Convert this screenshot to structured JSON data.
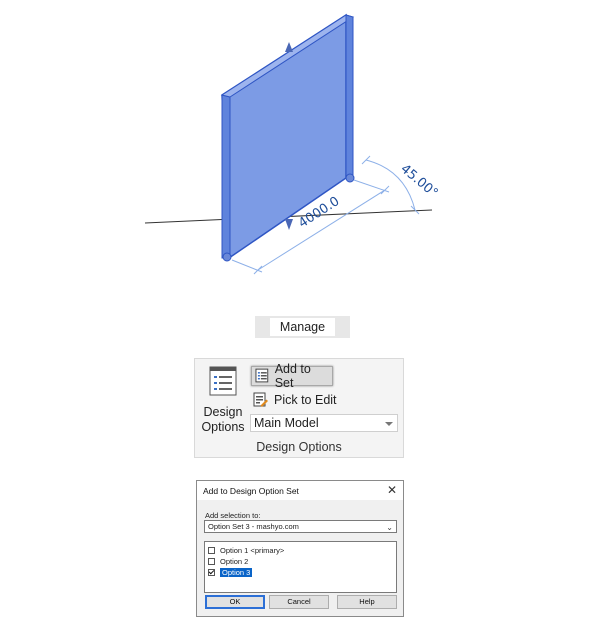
{
  "scene": {
    "dimension_length": "4000.0",
    "dimension_angle": "45.00°",
    "wall_color": "#7c9be5",
    "dimension_color": "#1f4e9a"
  },
  "manage_tab": {
    "label": "Manage"
  },
  "ribbon": {
    "design_options_label_line1": "Design",
    "design_options_label_line2": "Options",
    "add_to_set_label": "Add to Set",
    "pick_to_edit_label": "Pick to Edit",
    "model_select_value": "Main Model",
    "panel_title": "Design Options"
  },
  "dialog": {
    "title": "Add to Design Option Set",
    "close_glyph": "✕",
    "add_selection_label": "Add selection to:",
    "option_set_value": "Option Set 3 - mashyo.com",
    "options": [
      {
        "label": "Option 1 <primary>",
        "checked": false
      },
      {
        "label": "Option 2",
        "checked": false
      },
      {
        "label": "Option 3",
        "checked": true
      }
    ],
    "ok_label": "OK",
    "cancel_label": "Cancel",
    "help_label": "Help"
  }
}
